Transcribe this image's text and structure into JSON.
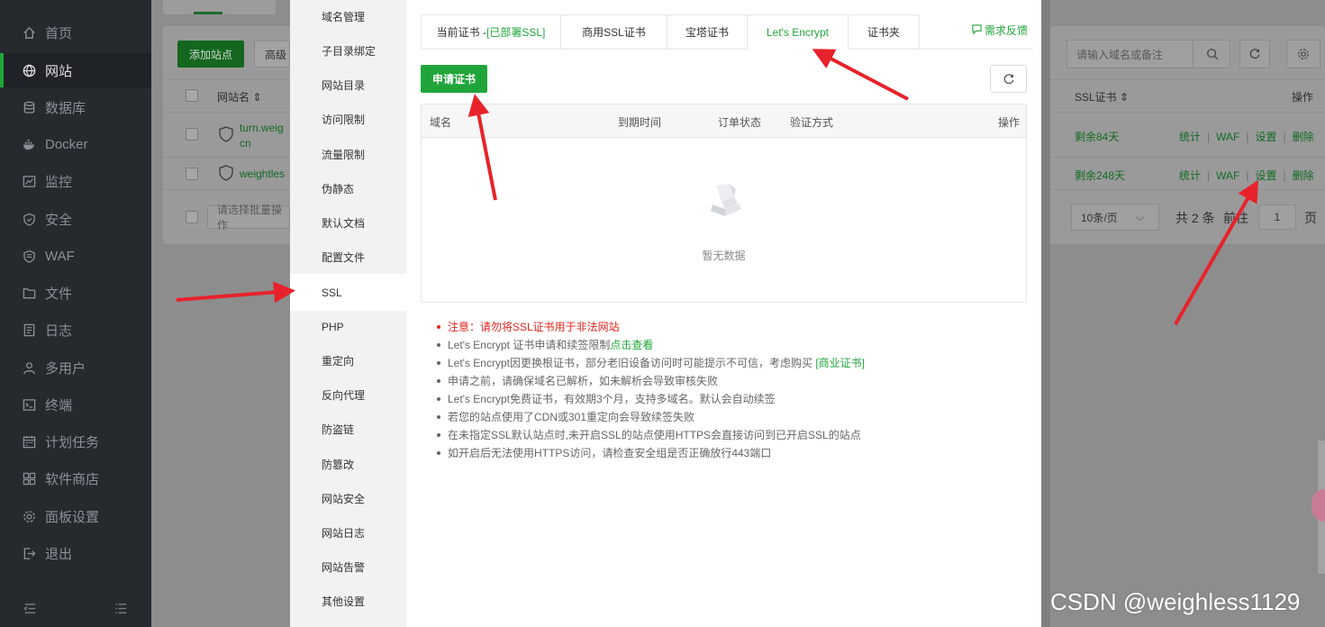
{
  "sidebar": {
    "items": [
      {
        "label": "首页",
        "icon": "home-icon"
      },
      {
        "label": "网站",
        "icon": "globe-icon",
        "active": true
      },
      {
        "label": "数据库",
        "icon": "database-icon"
      },
      {
        "label": "Docker",
        "icon": "docker-icon"
      },
      {
        "label": "监控",
        "icon": "monitor-icon"
      },
      {
        "label": "安全",
        "icon": "shield-icon"
      },
      {
        "label": "WAF",
        "icon": "waf-icon"
      },
      {
        "label": "文件",
        "icon": "folder-icon"
      },
      {
        "label": "日志",
        "icon": "log-icon"
      },
      {
        "label": "多用户",
        "icon": "users-icon"
      },
      {
        "label": "终端",
        "icon": "terminal-icon"
      },
      {
        "label": "计划任务",
        "icon": "calendar-icon"
      },
      {
        "label": "软件商店",
        "icon": "store-icon"
      },
      {
        "label": "面板设置",
        "icon": "gear-icon"
      },
      {
        "label": "退出",
        "icon": "logout-icon"
      }
    ]
  },
  "site_list": {
    "add_button": "添加站点",
    "advanced_button": "高级",
    "search_placeholder": "请输入域名或备注",
    "columns": {
      "name": "网站名",
      "ssl": "SSL证书",
      "actions": "操作"
    },
    "rows": [
      {
        "name_line1": "turn.weig",
        "name_line2": "cn",
        "ssl": "剩余84天"
      },
      {
        "name_line1": "weightles",
        "name_line2": "",
        "ssl": "剩余248天"
      }
    ],
    "row_actions": [
      "统计",
      "WAF",
      "设置",
      "删除"
    ],
    "batch_placeholder": "请选择批量操作",
    "page_size": "10条/页",
    "total_text": "共 2 条",
    "goto_label": "前往",
    "page_number": "1",
    "page_suffix": "页"
  },
  "dialog": {
    "menu": [
      "域名管理",
      "子目录绑定",
      "网站目录",
      "访问限制",
      "流量限制",
      "伪静态",
      "默认文档",
      "配置文件",
      "SSL",
      "PHP",
      "重定向",
      "反向代理",
      "防盗链",
      "防篡改",
      "网站安全",
      "网站日志",
      "网站告警",
      "其他设置"
    ],
    "active_menu": "SSL",
    "tabs": {
      "current_prefix": "当前证书 - ",
      "current_status": "[已部署SSL]",
      "commercial": "商用SSL证书",
      "baota": "宝塔证书",
      "letsencrypt": "Let's Encrypt",
      "folder": "证书夹"
    },
    "feedback": "需求反馈",
    "apply_button": "申请证书",
    "table_headers": {
      "domain": "域名",
      "expire": "到期时间",
      "order_status": "订单状态",
      "verify": "验证方式",
      "actions": "操作"
    },
    "empty_text": "暂无数据",
    "notes": [
      {
        "text": "注意：请勿将SSL证书用于非法网站"
      },
      {
        "text": "Let's Encrypt 证书申请和续签限制",
        "link": "点击查看"
      },
      {
        "text": "Let's Encrypt因更换根证书，部分老旧设备访问时可能提示不可信，考虑购买 ",
        "link": "[商业证书]"
      },
      {
        "text": "申请之前，请确保域名已解析，如未解析会导致审核失败"
      },
      {
        "text": "Let's Encrypt免费证书，有效期3个月，支持多域名。默认会自动续签"
      },
      {
        "text": "若您的站点使用了CDN或301重定向会导致续签失败"
      },
      {
        "text": "在未指定SSL默认站点时,未开启SSL的站点使用HTTPS会直接访问到已开启SSL的站点"
      },
      {
        "text": "如开启后无法使用HTTPS访问，请检查安全组是否正确放行443端口"
      }
    ]
  },
  "watermark": "CSDN @weighless1129",
  "colors": {
    "accent": "#20a53a",
    "warning": "#e1251b",
    "arrow": "#e8222a",
    "sidebar": "#262a2f"
  }
}
